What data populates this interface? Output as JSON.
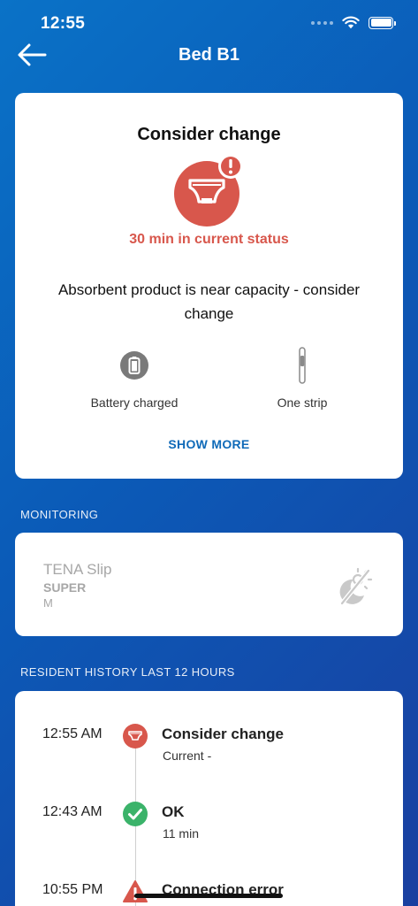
{
  "status_bar": {
    "time": "12:55"
  },
  "nav": {
    "title": "Bed B1"
  },
  "status_card": {
    "heading": "Consider change",
    "duration": "30 min in current status",
    "message": "Absorbent product is near capacity - consider change",
    "sensors": [
      {
        "icon": "battery-icon",
        "label": "Battery charged"
      },
      {
        "icon": "strip-icon",
        "label": "One strip"
      }
    ],
    "show_more": "SHOW MORE"
  },
  "monitoring": {
    "section_label": "MONITORING",
    "product_name": "TENA Slip",
    "product_size": "SUPER",
    "product_variant": "M",
    "icon": "night-mode-off-icon"
  },
  "history": {
    "section_label": "RESIDENT HISTORY LAST 12 HOURS",
    "entries": [
      {
        "time": "12:55 AM",
        "title": "Consider change",
        "sub": "Current -",
        "status": "change"
      },
      {
        "time": "12:43 AM",
        "title": "OK",
        "sub": "11 min",
        "status": "ok"
      },
      {
        "time": "10:55 PM",
        "title": "Connection error",
        "sub": "",
        "status": "error"
      }
    ]
  },
  "colors": {
    "alert_red": "#d8574c",
    "ok_green": "#3bb36a",
    "link_blue": "#0f6ab8"
  }
}
